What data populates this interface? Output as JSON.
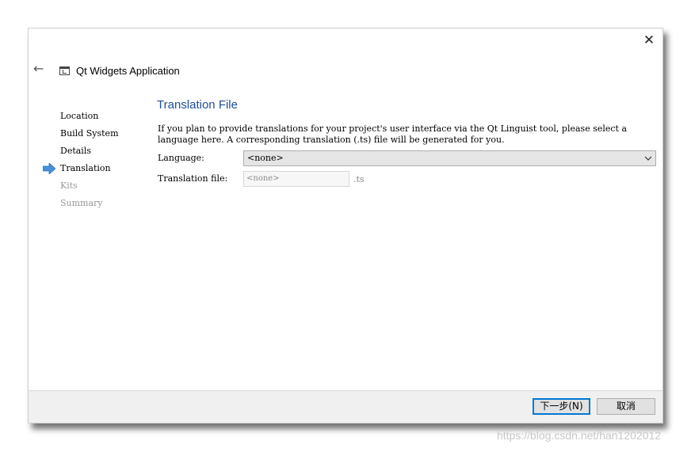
{
  "window": {
    "close_glyph": "✕",
    "back_glyph": "←",
    "app_title": "Qt Widgets Application"
  },
  "steps": [
    {
      "label": "Location",
      "state": "done"
    },
    {
      "label": "Build System",
      "state": "done"
    },
    {
      "label": "Details",
      "state": "done"
    },
    {
      "label": "Translation",
      "state": "current"
    },
    {
      "label": "Kits",
      "state": "pending"
    },
    {
      "label": "Summary",
      "state": "pending"
    }
  ],
  "page": {
    "title": "Translation File",
    "description": "If you plan to provide translations for your project's user interface via the Qt Linguist tool, please select a language here. A corresponding translation (.ts) file will be generated for you.",
    "language_label": "Language:",
    "language_value": "<none>",
    "translation_file_label": "Translation file:",
    "translation_file_value": "<none>",
    "ts_suffix": ".ts"
  },
  "footer": {
    "next_label": "下一步(N)",
    "cancel_label": "取消"
  },
  "watermark": "https://blog.csdn.net/han1202012",
  "colors": {
    "title_blue": "#1f4f99",
    "arrow_blue": "#4a90d9",
    "focus_blue": "#0078d7"
  }
}
